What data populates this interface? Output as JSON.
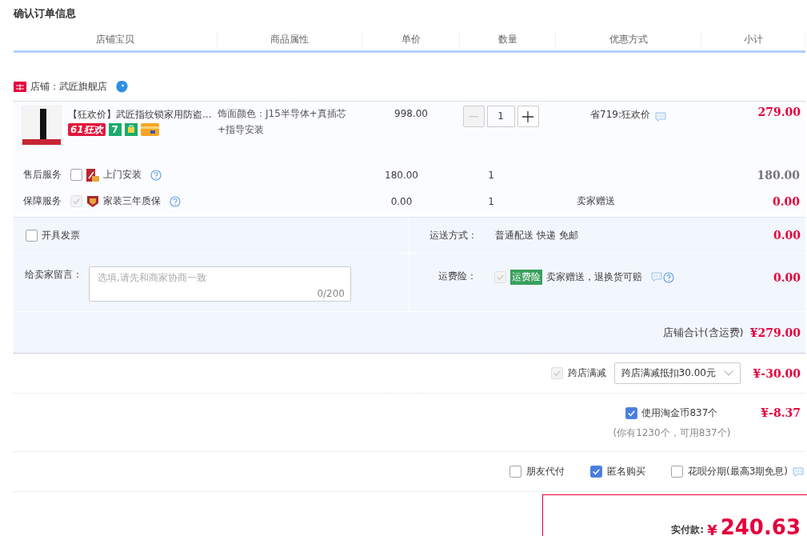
{
  "title": "确认订单信息",
  "columns": [
    "店铺宝贝",
    "商品属性",
    "单价",
    "数量",
    "优惠方式",
    "小计"
  ],
  "shop": {
    "label": "店铺：武匠旗舰店"
  },
  "item": {
    "title": "【狂欢价】武匠指纹锁家用防盗...",
    "promo_badge": "61狂欢",
    "return_badge": "7",
    "attribute": "饰面颜色：J15半导体+真插芯+指导安装",
    "price": "998.00",
    "quantity": "1",
    "minus_disabled": true,
    "discount": "省719:狂欢价",
    "subtotal": "279.00"
  },
  "services": [
    {
      "label": "售后服务",
      "kind": "install",
      "checked": false,
      "disabled": false,
      "name": "上门安装",
      "price": "180.00",
      "quantity": "1",
      "subtotal": "180.00"
    },
    {
      "label": "保障服务",
      "kind": "warranty",
      "checked": true,
      "disabled": true,
      "name": "家装三年质保",
      "price": "0.00",
      "quantity": "1",
      "offer": "卖家赠送",
      "subtotal": "0.00"
    }
  ],
  "invoice": {
    "label": "开具发票",
    "checked": false
  },
  "shipping": {
    "label": "运送方式：",
    "value": "普通配送 快递 免邮",
    "amount": "0.00"
  },
  "message": {
    "label": "给卖家留言：",
    "placeholder": "选填,请先和商家协商一致",
    "counter": "0/200"
  },
  "insurance": {
    "label": "运费险：",
    "checked": true,
    "disabled": true,
    "badge": "运费险",
    "text": "卖家赠送，退换货可赔",
    "amount": "0.00"
  },
  "shop_total": {
    "label": "店铺合计(含运费)",
    "amount": "¥279.00"
  },
  "cross_store": {
    "checked": true,
    "disabled": true,
    "label": "跨店满减",
    "select": "跨店满减抵扣30.00元",
    "amount": "¥-30.00"
  },
  "coins": {
    "checked": true,
    "disabled": false,
    "label": "使用淘金币837个",
    "note": "(你有1230个，可用837个)",
    "amount": "¥-8.37"
  },
  "options": [
    {
      "label": "朋友代付",
      "checked": false
    },
    {
      "label": "匿名购买",
      "checked": true
    },
    {
      "label": "花呗分期(最高3期免息)",
      "checked": false
    }
  ],
  "total": {
    "label": "实付款:",
    "currency": "¥",
    "amount": "240.63"
  }
}
